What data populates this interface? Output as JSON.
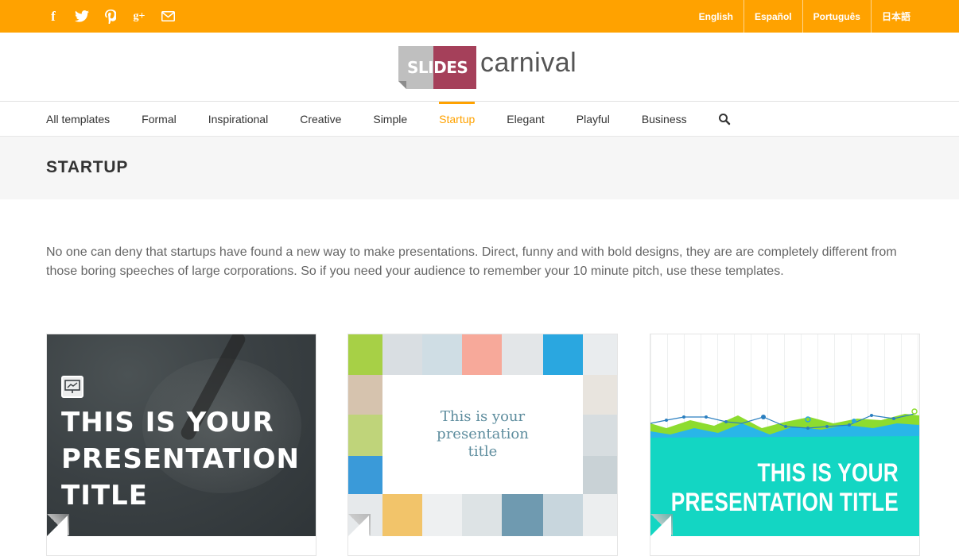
{
  "topbar": {
    "social_icons": [
      "facebook-icon",
      "twitter-icon",
      "pinterest-icon",
      "google-plus-icon",
      "mail-icon"
    ],
    "social_glyphs": {
      "facebook": "f",
      "googleplus": "g+"
    },
    "languages": [
      "English",
      "Español",
      "Português",
      "日本語"
    ],
    "color": "#ffa200"
  },
  "logo": {
    "slides": "SLIDES",
    "carnival": "carnival"
  },
  "nav": {
    "items": [
      "All templates",
      "Formal",
      "Inspirational",
      "Creative",
      "Simple",
      "Startup",
      "Elegant",
      "Playful",
      "Business"
    ],
    "active": "Startup",
    "search_icon": "search-icon"
  },
  "page": {
    "title": "STARTUP",
    "description": "No one can deny that startups have found a new way to make presentations. Direct, funny and with bold designs, they are are completely different from those boring speeches of large corporations. So if you need your audience to remember your 10 minute pitch, use these templates."
  },
  "cards": [
    {
      "title": "THIS IS YOUR\nPRESENTATION\nTITLE",
      "bg": "#3a4043"
    },
    {
      "title": "This is your\npresentation\ntitle",
      "text_color": "#5e8d9e"
    },
    {
      "title": "THIS IS YOUR\nPRESENTATION TITLE",
      "accent": "#13d6c3"
    }
  ]
}
